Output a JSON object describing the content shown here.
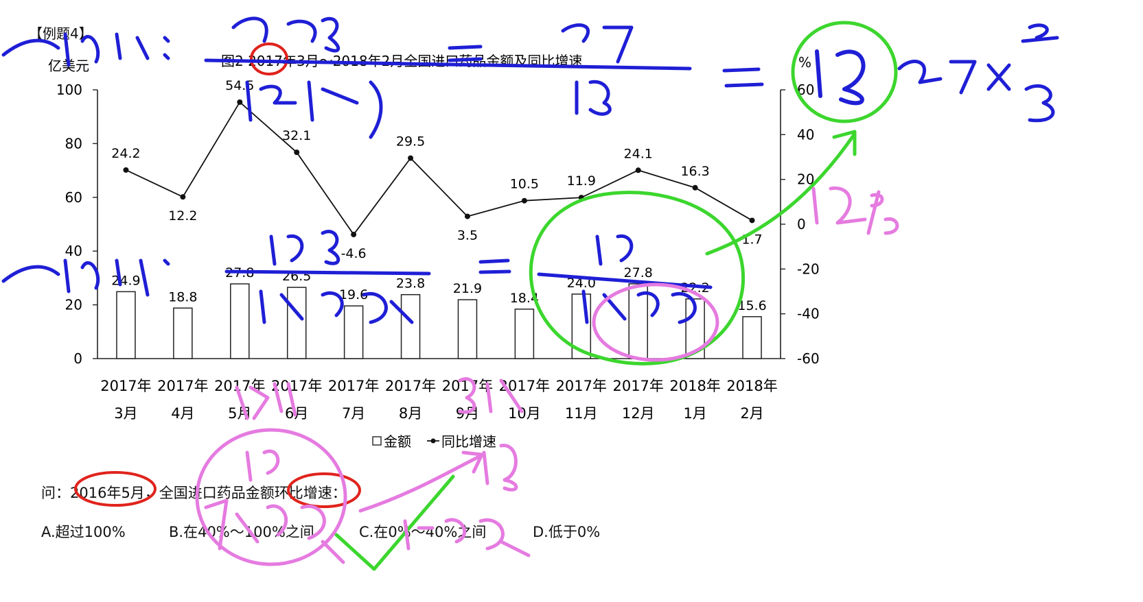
{
  "header": {
    "tag": "【例题4】"
  },
  "chart_data": {
    "type": "bar+line",
    "title": "图2  2017年3月～2018年2月全国进口药品金额及同比增速",
    "ylabel_left": "亿美元",
    "ylabel_right": "%",
    "categories": [
      [
        "2017年",
        "3月"
      ],
      [
        "2017年",
        "4月"
      ],
      [
        "2017年",
        "5月"
      ],
      [
        "2017年",
        "6月"
      ],
      [
        "2017年",
        "7月"
      ],
      [
        "2017年",
        "8月"
      ],
      [
        "2017年",
        "9月"
      ],
      [
        "2017年",
        "10月"
      ],
      [
        "2017年",
        "11月"
      ],
      [
        "2017年",
        "12月"
      ],
      [
        "2018年",
        "1月"
      ],
      [
        "2018年",
        "2月"
      ]
    ],
    "series": [
      {
        "name": "金额",
        "type": "bar",
        "axis": "left",
        "values": [
          24.9,
          18.8,
          27.8,
          26.5,
          19.6,
          23.8,
          21.9,
          18.4,
          24.0,
          27.8,
          22.2,
          15.6
        ]
      },
      {
        "name": "同比增速",
        "type": "line",
        "axis": "right",
        "values": [
          24.2,
          12.2,
          54.5,
          32.1,
          -4.6,
          29.5,
          3.5,
          10.5,
          11.9,
          24.1,
          16.3,
          1.7
        ]
      }
    ],
    "ylim_left": [
      0,
      100
    ],
    "yticks_left": [
      0,
      20,
      40,
      60,
      80,
      100
    ],
    "ylim_right": [
      -60,
      60
    ],
    "yticks_right": [
      -60,
      -40,
      -20,
      0,
      20,
      40,
      60
    ],
    "legend_position": "bottom",
    "grid": false
  },
  "question": {
    "text": "问：2016年5月，全国进口药品金额环比增速：",
    "options": [
      "A.超过100%",
      "B.在40%～100%之间",
      "C.在0%～40%之间",
      "D.低于0%"
    ]
  },
  "colors": {
    "blue_ink": "#1f1fd6",
    "green_ink": "#3cd62e",
    "pink_ink": "#e57be0",
    "red_ink": "#e0231c"
  }
}
